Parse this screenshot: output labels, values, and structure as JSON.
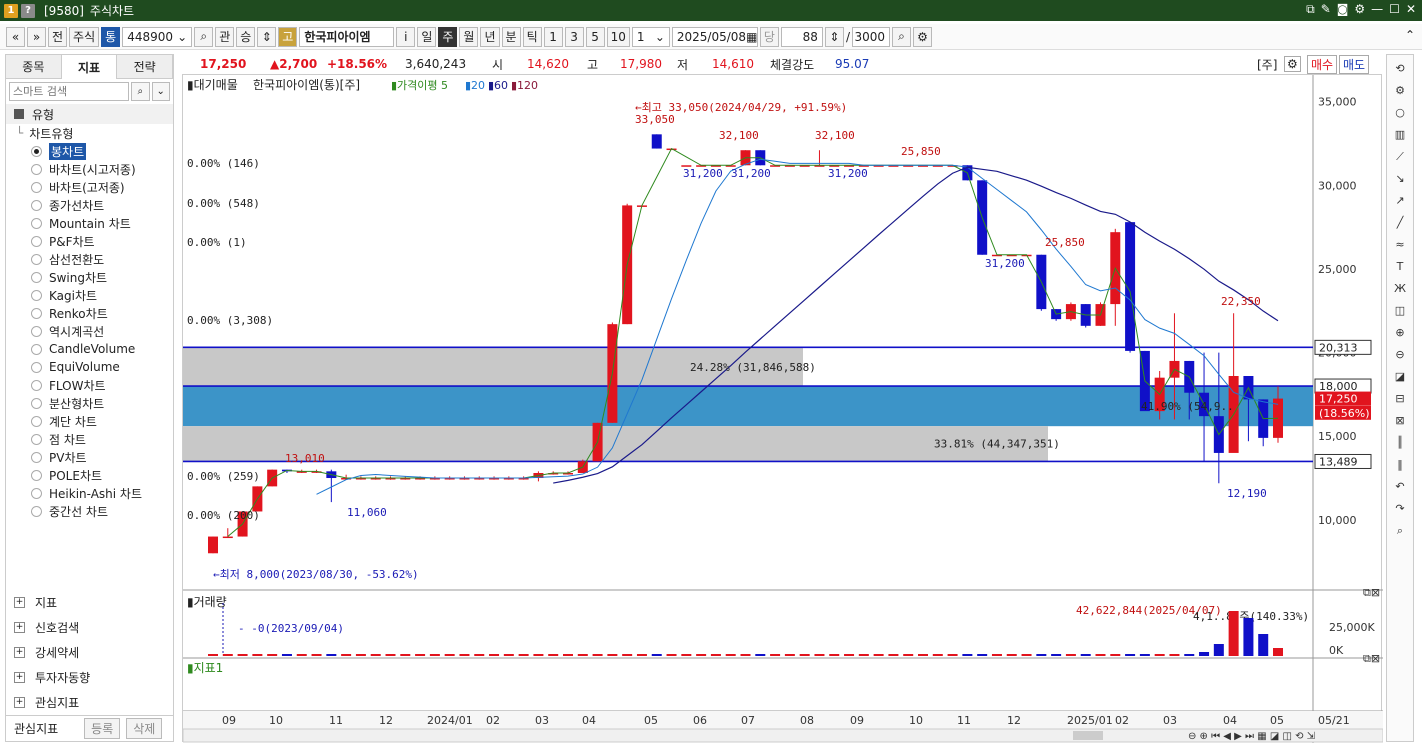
{
  "window": {
    "code": "[9580]",
    "title": "주식차트",
    "badge1": "1",
    "badge2": "?"
  },
  "toolbar": {
    "prev": "«",
    "down": "»",
    "jeon": "전",
    "market": "주식",
    "tong": "통",
    "code": "448900",
    "gwan": "관",
    "seung": "승",
    "go": "고",
    "name": "한국피아이엠",
    "info": "i",
    "periods": [
      "일",
      "주",
      "월",
      "년",
      "분",
      "틱"
    ],
    "active_period": "주",
    "nums": [
      "1",
      "3",
      "5",
      "10"
    ],
    "unit": "1",
    "date": "2025/05/08",
    "dang": "당",
    "count": "88",
    "slash": "/",
    "total": "3000"
  },
  "left_panel": {
    "tabs": [
      "종목",
      "지표",
      "전략"
    ],
    "active_tab": "지표",
    "search_placeholder": "스마트 검색",
    "section": "유형",
    "tree_root": "차트유형",
    "chart_types": [
      "봉차트",
      "바차트(시고저종)",
      "바차트(고저종)",
      "종가선차트",
      "Mountain 차트",
      "P&F차트",
      "삼선전환도",
      "Swing차트",
      "Kagi차트",
      "Renko차트",
      "역시계곡선",
      "CandleVolume",
      "EquiVolume",
      "FLOW차트",
      "분산형차트",
      "계단 차트",
      "점 차트",
      "PV차트",
      "POLE차트",
      "Heikin-Ashi 차트",
      "중간선 차트"
    ],
    "selected": "봉차트",
    "lower_sections": [
      "지표",
      "신호검색",
      "강세약세",
      "투자자동향",
      "관심지표"
    ],
    "fav_label": "관심지표",
    "register": "등록",
    "delete": "삭제"
  },
  "infobar": {
    "price": "17,250",
    "change": "▲2,700",
    "pct": "+18.56%",
    "volume": "3,640,243",
    "open_label": "시",
    "open": "14,620",
    "high_label": "고",
    "high": "17,980",
    "low_label": "저",
    "low": "14,610",
    "strength_label": "체결강도",
    "strength": "95.07",
    "unit_label": "[주]",
    "buy": "매수",
    "sell": "매도"
  },
  "chart": {
    "legend": [
      "대기매물",
      "한국피아이엠(통)[주]",
      "가격이평 5",
      "20",
      "60",
      "120"
    ],
    "max_note": "←최고 33,050(2024/04/29, +91.59%)",
    "min_note": "←최저 8,000(2023/08/30, -53.62%)",
    "volume_title": "거래량",
    "volume_note": "0(2023/09/04)",
    "volume_max_note": "42,622,844(2025/04/07)",
    "volume_last_note": "4,1..82주(140.33%)",
    "indicator_title": "지표1",
    "y_ticks": [
      "35,000",
      "30,000",
      "25,000",
      "20,000",
      "15,000",
      "10,000"
    ],
    "vol_ticks": [
      "25,000K",
      "0K"
    ],
    "x_ticks": [
      "09",
      "10",
      "11",
      "12",
      "2024/01",
      "02",
      "03",
      "04",
      "05",
      "06",
      "07",
      "08",
      "09",
      "10",
      "11",
      "12",
      "2025/01",
      "02",
      "03",
      "04",
      "05",
      "05/21"
    ],
    "price_tags": [
      "20,313",
      "18,000",
      "17,250",
      "(18.56%)",
      "13,489"
    ],
    "zones": [
      "24.28% (31,846,588)",
      "41.90% (54,9..",
      "33.81% (44,347,351)"
    ],
    "pct_labels": [
      "0.00% (146)",
      "0.00% (548)",
      "0.00% (1)",
      "0.00% (3,308)",
      "0.00% (259)",
      "0.00% (200)"
    ],
    "annotations": [
      "33,050",
      "32,100",
      "32,100",
      "31,200",
      "31,200",
      "31,200",
      "31,200",
      "25,850",
      "25,850",
      "22,350",
      "13,010",
      "11,060",
      "12,190"
    ]
  },
  "colors": {
    "up": "#e1141e",
    "down": "#1010c8",
    "ma5": "#2f8a1f",
    "ma20": "#1f78d0",
    "ma60": "#1a1a8a",
    "zone_gray": "#c8c8c8",
    "zone_blue": "#3c94c8",
    "title_bg": "#1f4b1f"
  },
  "chart_data": {
    "type": "candlestick",
    "title": "한국피아이엠(통)[주]",
    "ylim": [
      7000,
      36000
    ],
    "x": [
      "2023/08",
      "2023/09a",
      "2023/09b",
      "2023/09c",
      "2023/10a",
      "2023/10b",
      "2023/10c",
      "2023/10d",
      "2023/11a",
      "2023/11b",
      "2023/11c",
      "2023/11d",
      "2023/12a",
      "2023/12b",
      "2023/12c",
      "2023/12d",
      "2024/01a",
      "2024/01b",
      "2024/01c",
      "2024/01d",
      "2024/02a",
      "2024/02b",
      "2024/02c",
      "2024/02d",
      "2024/03a",
      "2024/03b",
      "2024/03c",
      "2024/03d",
      "2024/04a",
      "2024/04b",
      "2024/04c",
      "2024/04d",
      "2024/05a",
      "2024/05b",
      "2024/05c",
      "2024/05d",
      "2024/06a",
      "2024/06b",
      "2024/06c",
      "2024/06d",
      "2024/07a",
      "2024/07b",
      "2024/07c",
      "2024/07d",
      "2024/08a",
      "2024/08b",
      "2024/08c",
      "2024/08d",
      "2024/09a",
      "2024/09b",
      "2024/09c",
      "2024/09d",
      "2024/10a",
      "2024/10b",
      "2024/10c",
      "2024/10d",
      "2024/11a",
      "2024/11b",
      "2024/11c",
      "2024/11d",
      "2024/12a",
      "2024/12b",
      "2024/12c",
      "2024/12d",
      "2025/01a",
      "2025/01b",
      "2025/01c",
      "2025/01d",
      "2025/02a",
      "2025/02b",
      "2025/02c",
      "2025/02d",
      "2025/03a",
      "2025/03b",
      "2025/03c",
      "2025/03d",
      "2025/04a",
      "2025/04b",
      "2025/04c",
      "2025/04d",
      "2025/05a",
      "2025/05b"
    ],
    "ohlc": [
      [
        8000,
        9000,
        8000,
        9000
      ],
      [
        9000,
        9500,
        9000,
        9000
      ],
      [
        9000,
        10500,
        9000,
        10500
      ],
      [
        10500,
        12000,
        10500,
        12000
      ],
      [
        12000,
        13010,
        12000,
        13000
      ],
      [
        13000,
        13000,
        12800,
        12900
      ],
      [
        12900,
        13000,
        12800,
        12900
      ],
      [
        12900,
        13000,
        12800,
        12900
      ],
      [
        12900,
        13000,
        11060,
        12500
      ],
      [
        12500,
        12700,
        12400,
        12500
      ],
      [
        12500,
        12600,
        12400,
        12500
      ],
      [
        12500,
        12600,
        12400,
        12500
      ],
      [
        12500,
        12600,
        12400,
        12500
      ],
      [
        12500,
        12600,
        12400,
        12500
      ],
      [
        12500,
        12600,
        12400,
        12500
      ],
      [
        12500,
        12600,
        12400,
        12500
      ],
      [
        12500,
        12600,
        12400,
        12500
      ],
      [
        12500,
        12600,
        12400,
        12500
      ],
      [
        12500,
        12600,
        12400,
        12500
      ],
      [
        12500,
        12600,
        12400,
        12500
      ],
      [
        12500,
        12600,
        12400,
        12500
      ],
      [
        12500,
        12600,
        12400,
        12500
      ],
      [
        12500,
        12900,
        12300,
        12800
      ],
      [
        12800,
        12900,
        12700,
        12800
      ],
      [
        12800,
        12900,
        12700,
        12800
      ],
      [
        12800,
        13600,
        12800,
        13500
      ],
      [
        13500,
        15800,
        13500,
        15800
      ],
      [
        15800,
        21800,
        15800,
        21700
      ],
      [
        21700,
        28900,
        21700,
        28800
      ],
      [
        28800,
        28800,
        28800,
        28800
      ],
      [
        33050,
        33050,
        32200,
        32200
      ],
      [
        32200,
        32200,
        32200,
        32200
      ],
      [
        31200,
        31200,
        31200,
        31200
      ],
      [
        31200,
        31200,
        31200,
        31200
      ],
      [
        31200,
        31200,
        31200,
        31200
      ],
      [
        31200,
        31200,
        31200,
        31200
      ],
      [
        31200,
        32100,
        31200,
        32100
      ],
      [
        32100,
        32100,
        31200,
        31200
      ],
      [
        31200,
        31200,
        31200,
        31200
      ],
      [
        31200,
        31200,
        31200,
        31200
      ],
      [
        31200,
        31200,
        31200,
        31200
      ],
      [
        31200,
        32100,
        31200,
        31200
      ],
      [
        31200,
        31200,
        31200,
        31200
      ],
      [
        31200,
        31200,
        31200,
        31200
      ],
      [
        31200,
        31200,
        31200,
        31200
      ],
      [
        31200,
        31200,
        31200,
        31200
      ],
      [
        31200,
        31200,
        31200,
        31200
      ],
      [
        31200,
        31200,
        31200,
        31200
      ],
      [
        31200,
        31200,
        31200,
        31200
      ],
      [
        31200,
        31200,
        31200,
        31200
      ],
      [
        31200,
        31200,
        31200,
        31200
      ],
      [
        31200,
        31200,
        30300,
        30300
      ],
      [
        30300,
        30300,
        25850,
        25850
      ],
      [
        25850,
        25850,
        25850,
        25850
      ],
      [
        25850,
        25850,
        25850,
        25850
      ],
      [
        25850,
        25850,
        25850,
        25850
      ],
      [
        25850,
        25850,
        22500,
        22600
      ],
      [
        22600,
        22600,
        21900,
        22000
      ],
      [
        22000,
        23000,
        21900,
        22900
      ],
      [
        22900,
        22900,
        21500,
        21600
      ],
      [
        21600,
        23000,
        21600,
        22900
      ],
      [
        22900,
        27400,
        21600,
        27200
      ],
      [
        27800,
        27800,
        20000,
        20100
      ],
      [
        20100,
        20100,
        17000,
        16500
      ],
      [
        16500,
        18900,
        16000,
        18500
      ],
      [
        18500,
        22350,
        16000,
        19500
      ],
      [
        19500,
        19500,
        16000,
        17600
      ],
      [
        17600,
        20000,
        13500,
        16200
      ],
      [
        16200,
        20000,
        12190,
        14000
      ],
      [
        14000,
        22350,
        14300,
        18600
      ],
      [
        18600,
        18600,
        14700,
        17200
      ],
      [
        17200,
        17200,
        14400,
        14900
      ],
      [
        14900,
        17980,
        14610,
        17250
      ]
    ],
    "ma5": [],
    "ma20": [],
    "ma60": [],
    "volume": [],
    "legend": [
      "가격이평 5",
      "20",
      "60",
      "120"
    ]
  }
}
